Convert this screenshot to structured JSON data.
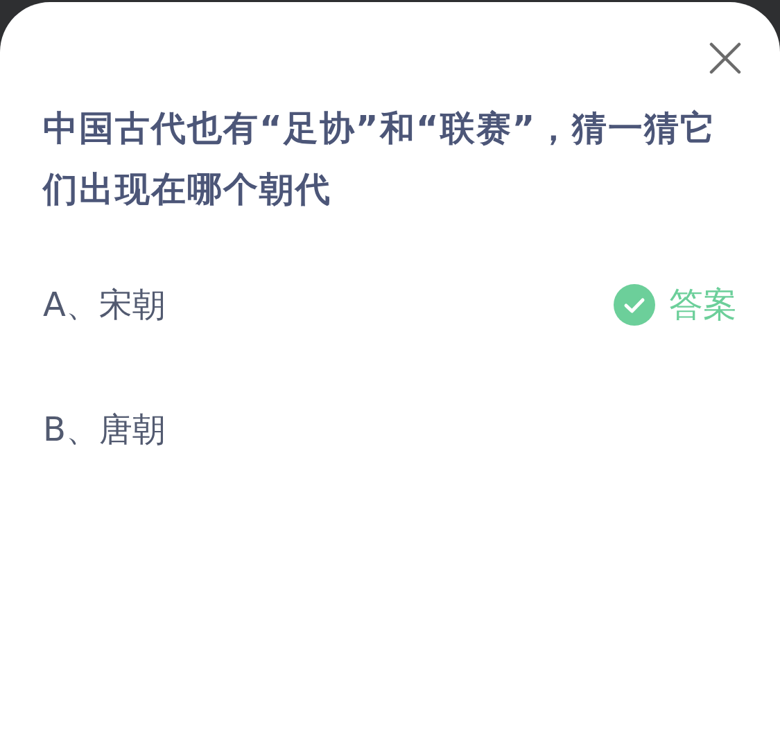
{
  "question": "中国古代也有“足协”和“联赛”，猜一猜它们出现在哪个朝代",
  "options": [
    {
      "label": "A、宋朝",
      "correct": true,
      "badge": "答案"
    },
    {
      "label": "B、唐朝",
      "correct": false
    }
  ]
}
